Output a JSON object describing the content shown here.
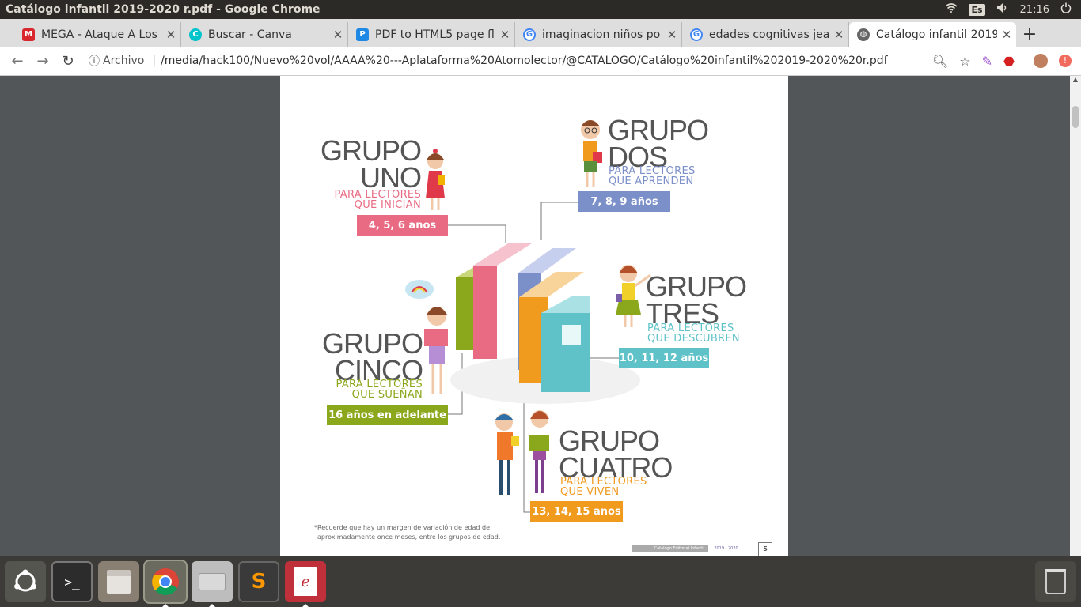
{
  "window": {
    "title": "Catálogo infantil 2019-2020 r.pdf - Google Chrome"
  },
  "system": {
    "lang": "Es",
    "time": "21:16",
    "icons": [
      "wifi-icon",
      "volume-icon",
      "power-icon"
    ]
  },
  "tabs": [
    {
      "label": "MEGA - Ataque A Los",
      "favicon": "M",
      "color": "#d9272e"
    },
    {
      "label": "Buscar - Canva",
      "favicon": "C",
      "color": "#00c4cc"
    },
    {
      "label": "PDF to HTML5 page fl",
      "favicon": "P",
      "color": "#1e88e5"
    },
    {
      "label": "imaginacion niños po",
      "favicon": "G",
      "color": "#4285f4"
    },
    {
      "label": "edades cognitivas jea",
      "favicon": "G",
      "color": "#4285f4"
    },
    {
      "label": "Catálogo infantil 2019",
      "favicon": "",
      "color": "#555555"
    }
  ],
  "address": {
    "scheme": "Archivo",
    "url": "/media/hack100/Nuevo%20vol/AAAA%20---Aplataforma%20Atomolector/@CATALOGO/Catálogo%20infantil%202019-2020%20r.pdf"
  },
  "page": {
    "groups": [
      {
        "line1": "GRUPO",
        "line2": "UNO",
        "sub1": "PARA LECTORES",
        "sub2": "QUE INICIAN",
        "age": "4, 5, 6 años",
        "color": "#e96b83"
      },
      {
        "line1": "GRUPO",
        "line2": "DOS",
        "sub1": "PARA LECTORES",
        "sub2": "QUE APRENDEN",
        "age": "7, 8, 9 años",
        "color": "#7b8fc9"
      },
      {
        "line1": "GRUPO",
        "line2": "TRES",
        "sub1": "PARA LECTORES",
        "sub2": "QUE DESCUBREN",
        "age": "10, 11, 12 años",
        "color": "#5ec2c8"
      },
      {
        "line1": "GRUPO",
        "line2": "CUATRO",
        "sub1": "PARA LECTORES",
        "sub2": "QUE VIVEN",
        "age": "13, 14, 15 años",
        "color": "#f09a1e"
      },
      {
        "line1": "GRUPO",
        "line2": "CINCO",
        "sub1": "PARA LECTORES",
        "sub2": "QUE SUEÑAN",
        "age": "16 años en adelante",
        "color": "#8ba71c"
      }
    ],
    "footnote1": "*Recuerde que hay un margen de variación de edad de",
    "footnote2": "aproximadamente once meses, entre los grupos de edad.",
    "footer_label": "Catálogo Editorial Infantil",
    "footer_year": "2019 - 2020",
    "page_number": "5"
  },
  "dock": [
    "ubuntu-logo-icon",
    "terminal-icon",
    "files-icon",
    "chrome-icon",
    "disk-icon",
    "sublime-text-icon",
    "pdf-reader-icon",
    "trash-icon"
  ]
}
